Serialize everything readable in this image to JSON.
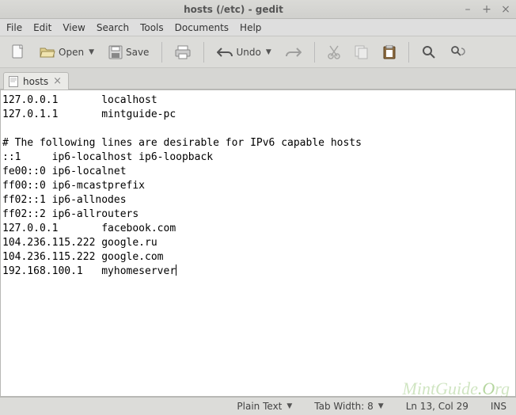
{
  "window": {
    "title": "hosts (/etc) - gedit",
    "buttons": {
      "min": "–",
      "max": "+",
      "close": "×"
    }
  },
  "menu": [
    "File",
    "Edit",
    "View",
    "Search",
    "Tools",
    "Documents",
    "Help"
  ],
  "toolbar": {
    "open": "Open",
    "save": "Save",
    "undo": "Undo"
  },
  "tab": {
    "label": "hosts",
    "close": "×"
  },
  "content": "127.0.0.1       localhost\n127.0.1.1       mintguide-pc\n\n# The following lines are desirable for IPv6 capable hosts\n::1     ip6-localhost ip6-loopback\nfe00::0 ip6-localnet\nff00::0 ip6-mcastprefix\nff02::1 ip6-allnodes\nff02::2 ip6-allrouters\n127.0.0.1       facebook.com\n104.236.115.222 google.ru\n104.236.115.222 google.com\n192.168.100.1   myhomeserver",
  "status": {
    "syntax": "Plain Text",
    "tabwidth": "Tab Width: 8",
    "position": "Ln 13, Col 29",
    "mode": "INS"
  },
  "watermark": "MintGuide.Org"
}
